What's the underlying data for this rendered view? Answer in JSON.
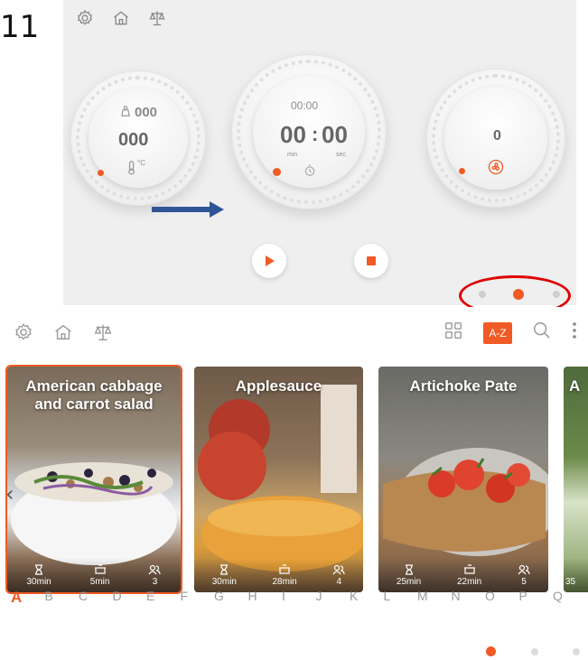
{
  "step_number": "11",
  "appliance_screen": {
    "left_dial": {
      "weight": "000",
      "value": "000",
      "temp_unit": "°C"
    },
    "center_dial": {
      "small_time": "00:00",
      "minutes": "00",
      "colon": ":",
      "seconds": "00",
      "min_label": "min",
      "sec_label": "sec"
    },
    "right_dial": {
      "value": "0"
    },
    "pager": {
      "count": 3,
      "active_index": 1
    }
  },
  "recipe_browser": {
    "toolbar": {
      "az_label": "A-Z"
    },
    "recipes": [
      {
        "title": "American cabbage and carrot salad",
        "time": "30min",
        "cook_time": "5min",
        "servings": "3",
        "selected": true
      },
      {
        "title": "Applesauce",
        "time": "30min",
        "cook_time": "28min",
        "servings": "4",
        "selected": false
      },
      {
        "title": "Artichoke Pate",
        "time": "25min",
        "cook_time": "22min",
        "servings": "5",
        "selected": false
      },
      {
        "title": "A",
        "time": "35",
        "cook_time": "",
        "servings": "",
        "selected": false
      }
    ],
    "prev_arrow": "‹",
    "alphabet": [
      "A",
      "B",
      "C",
      "D",
      "E",
      "F",
      "G",
      "H",
      "I",
      "J",
      "K",
      "L",
      "M",
      "N",
      "O",
      "P",
      "Q"
    ],
    "active_letter": "A",
    "pager": {
      "count": 3,
      "active_index": 0
    }
  },
  "colors": {
    "accent": "#f15a24",
    "annotation_red": "#e00000",
    "arrow_blue": "#2f5597"
  },
  "icons": [
    "gear-icon",
    "home-icon",
    "scale-icon",
    "grid-icon",
    "search-icon",
    "more-vertical-icon",
    "hourglass-icon",
    "pot-icon",
    "people-icon",
    "play-icon",
    "stop-icon",
    "thermometer-icon",
    "timer-icon",
    "fan-icon",
    "weight-icon"
  ]
}
